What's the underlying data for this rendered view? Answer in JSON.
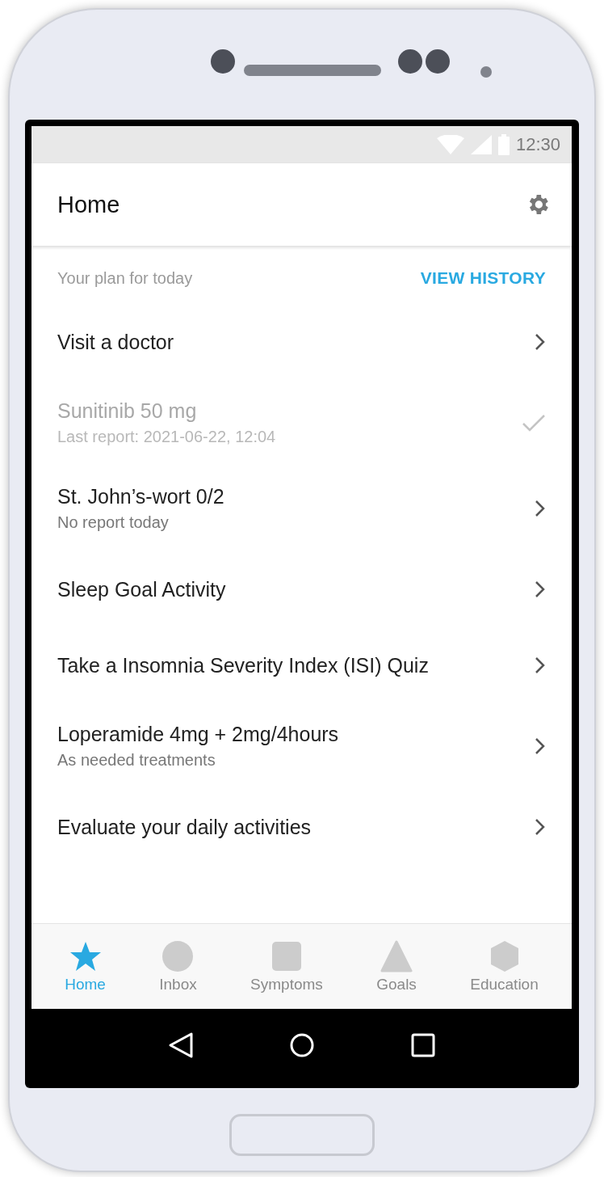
{
  "status_bar": {
    "time": "12:30"
  },
  "app_bar": {
    "title": "Home"
  },
  "plan": {
    "heading": "Your plan for today",
    "action": "VIEW HISTORY"
  },
  "items": [
    {
      "title": "Visit a doctor",
      "done": false
    },
    {
      "title": "Sunitinib 50 mg",
      "subtitle": "Last report: 2021-06-22, 12:04",
      "done": true
    },
    {
      "title": "St. John’s-wort 0/2",
      "subtitle": "No report today",
      "done": false
    },
    {
      "title": "Sleep Goal Activity",
      "done": false
    },
    {
      "title": "Take a Insomnia Severity Index (ISI) Quiz",
      "done": false
    },
    {
      "title": "Loperamide 4mg + 2mg/4hours",
      "subtitle": "As needed treatments",
      "done": false
    },
    {
      "title": "Evaluate your daily activities",
      "done": false
    }
  ],
  "bottom_nav": [
    {
      "label": "Home",
      "kind": "star",
      "selected": true
    },
    {
      "label": "Inbox",
      "kind": "circle",
      "selected": false
    },
    {
      "label": "Symptoms",
      "kind": "square",
      "selected": false
    },
    {
      "label": "Goals",
      "kind": "triangle",
      "selected": false
    },
    {
      "label": "Education",
      "kind": "hexagon",
      "selected": false
    }
  ]
}
